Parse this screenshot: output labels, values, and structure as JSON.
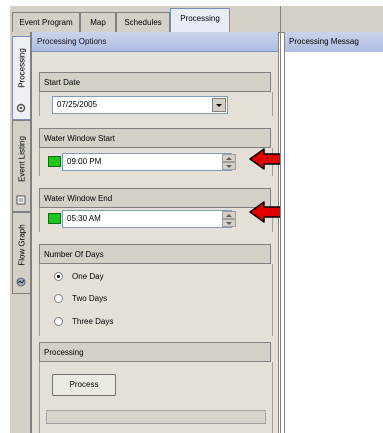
{
  "tabs": [
    "Event Program",
    "Map",
    "Schedules",
    "Processing"
  ],
  "active_tab": "Processing",
  "side_tabs": [
    {
      "label": "Processing",
      "icon": "gear-icon"
    },
    {
      "label": "Event Listing",
      "icon": "list-icon"
    },
    {
      "label": "Flow Graph",
      "icon": "graph-icon"
    }
  ],
  "panel": {
    "title": "Processing Options",
    "start_date_label": "Start Date",
    "start_date_value": "07/25/2005",
    "water_start_label": "Water Window Start",
    "water_start_value": "09:00 PM",
    "water_end_label": "Water Window End",
    "water_end_value": "05:30 AM",
    "days_label": "Number Of Days",
    "day_options": [
      "One Day",
      "Two Days",
      "Three Days"
    ],
    "selected_day_option": "One Day",
    "processing_label": "Processing",
    "process_button": "Process",
    "progress": 0
  },
  "messages": {
    "title": "Processing Messag"
  },
  "colors": {
    "indicator_green": "#1ec71e",
    "arrow_red": "#e00000",
    "header_blue": "#aebee2"
  }
}
